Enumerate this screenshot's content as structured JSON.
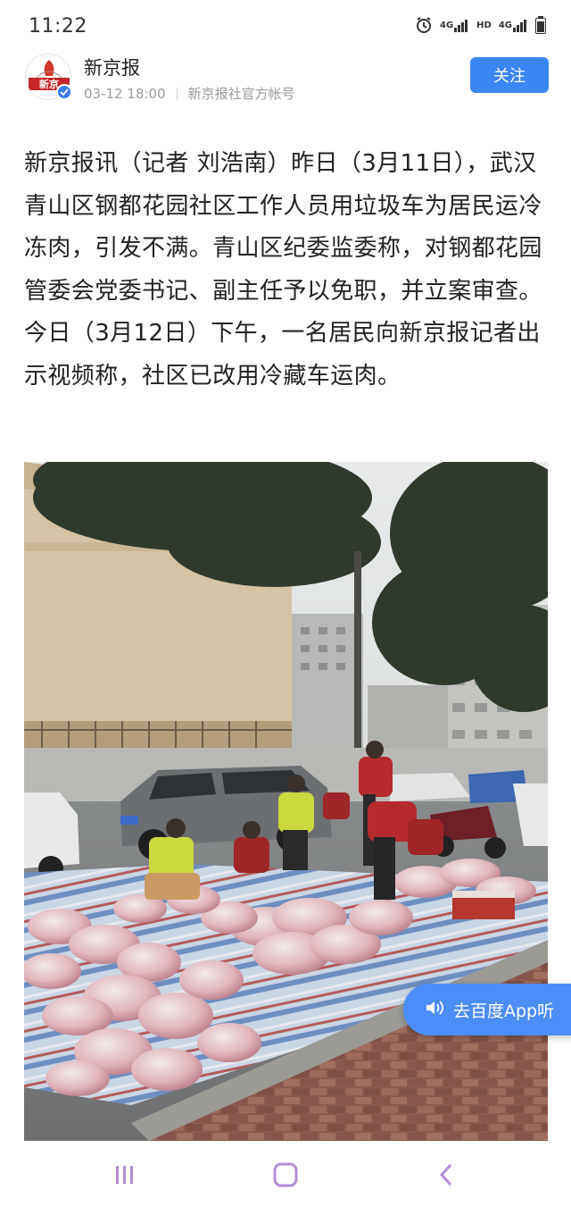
{
  "status_bar": {
    "time": "11:22",
    "network_1": "4G",
    "hd": "HD",
    "network_2": "4G",
    "icons": [
      "alarm-icon",
      "signal-icon",
      "signal-icon",
      "battery-icon"
    ]
  },
  "header": {
    "avatar_text": "新京",
    "account_name": "新京报",
    "date": "03-12 18:00",
    "source": "新京报社官方帐号",
    "follow_label": "关注",
    "accent_color": "#3a86f5"
  },
  "article": {
    "body": "新京报讯（记者 刘浩南）昨日（3月11日），武汉青山区钢都花园社区工作人员用垃圾车为居民运冷冻肉，引发不满。青山区纪委监委称，对钢都花园管委会党委书记、副主任予以免职，并立案审查。今日（3月12日）下午，一名居民向新京报记者出示视频称，社区已改用冷藏车运肉。"
  },
  "listen_button": {
    "label": "去百度App听",
    "icon": "speaker-icon"
  },
  "nav_bar": {
    "icons": [
      "recent-apps-icon",
      "home-icon",
      "back-icon"
    ]
  }
}
